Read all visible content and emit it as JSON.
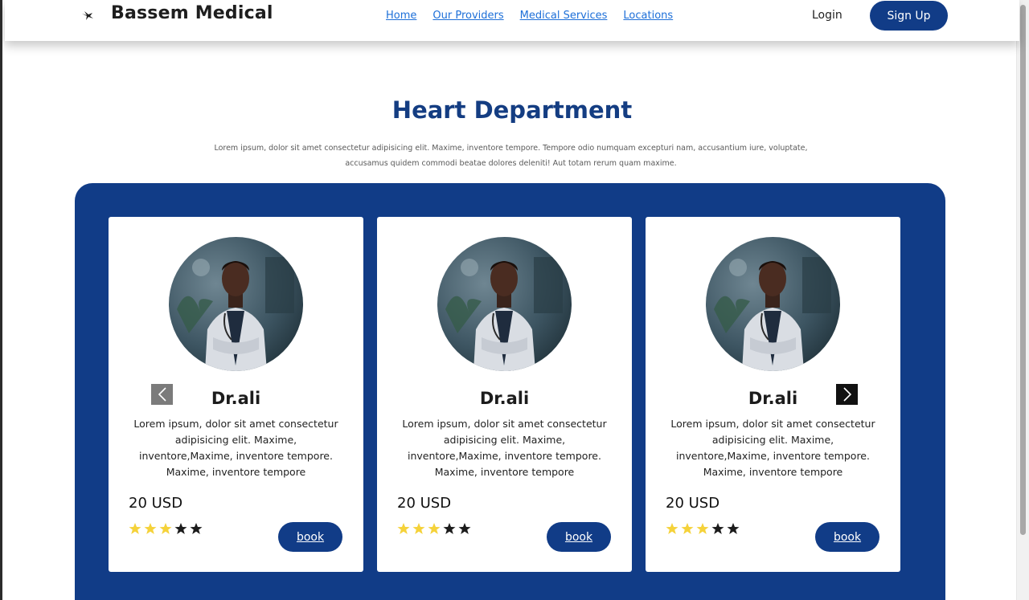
{
  "header": {
    "brand": "Bassem Medical",
    "nav": [
      "Home",
      "Our Providers",
      "Medical Services",
      "Locations"
    ],
    "login": "Login",
    "signup": "Sign Up"
  },
  "section": {
    "title": "Heart Department",
    "description": "Lorem ipsum, dolor sit amet consectetur adipisicing elit. Maxime, inventore tempore. Tempore odio numquam excepturi nam, accusantium iure, voluptate, accusamus quidem commodi beatae dolores deleniti! Aut totam rerum quam maxime."
  },
  "cards": [
    {
      "name": "Dr.ali",
      "description": "Lorem ipsum, dolor sit amet consectetur adipisicing elit. Maxime, inventore,Maxime, inventore tempore. Maxime, inventore tempore",
      "price": "20 USD",
      "rating": 3,
      "rating_max": 5,
      "book": "book"
    },
    {
      "name": "Dr.ali",
      "description": "Lorem ipsum, dolor sit amet consectetur adipisicing elit. Maxime, inventore,Maxime, inventore tempore. Maxime, inventore tempore",
      "price": "20 USD",
      "rating": 3,
      "rating_max": 5,
      "book": "book"
    },
    {
      "name": "Dr.ali",
      "description": "Lorem ipsum, dolor sit amet consectetur adipisicing elit. Maxime, inventore,Maxime, inventore tempore. Maxime, inventore tempore",
      "price": "20 USD",
      "rating": 3,
      "rating_max": 5,
      "book": "book"
    }
  ],
  "icons": {
    "logo": "bird-logo-icon",
    "prev": "chevron-left-icon",
    "next": "chevron-right-icon",
    "star": "star-icon"
  },
  "colors": {
    "brand_blue": "#113c87",
    "title_blue": "#143d82",
    "link_blue": "#1d6fd8",
    "star_filled": "#f5d23a",
    "star_empty": "#1c1c1c",
    "prev_arrow_bg": "#7b7b7b",
    "next_arrow_bg": "#111111"
  }
}
